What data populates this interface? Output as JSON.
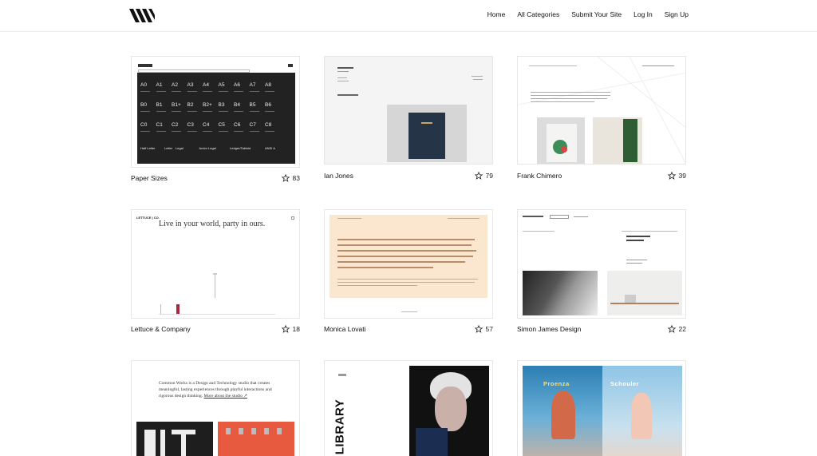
{
  "header": {
    "logo_icon": "site-logo-icon",
    "nav": [
      "Home",
      "All Categories",
      "Submit Your Site",
      "Log In",
      "Sign Up"
    ]
  },
  "cards": [
    {
      "title": "Paper Sizes",
      "favorites": "83"
    },
    {
      "title": "Ian Jones",
      "favorites": "79"
    },
    {
      "title": "Frank Chimero",
      "favorites": "39"
    },
    {
      "title": "Lettuce & Company",
      "favorites": "18"
    },
    {
      "title": "Monica Lovati",
      "favorites": "57"
    },
    {
      "title": "Simon James Design",
      "favorites": "22"
    }
  ],
  "thumbs": {
    "paper_sizes": {
      "row1": [
        "A0",
        "A1",
        "A2",
        "A3",
        "A4",
        "A5",
        "A6",
        "A7",
        "A8"
      ],
      "row2": [
        "B0",
        "B1",
        "B1+",
        "B2",
        "B2+",
        "B3",
        "B4",
        "B5",
        "B6"
      ],
      "row3": [
        "C0",
        "C1",
        "C2",
        "C3",
        "C4",
        "C5",
        "C6",
        "C7",
        "C8"
      ],
      "row4": [
        "Half Letter",
        "Letter",
        "Legal",
        "Junior Legal",
        "Ledger/Tabloid",
        "ANSI A"
      ]
    },
    "lettuce": {
      "brand": "LETTUCE | CO.",
      "headline": "Live in your world, party in ours."
    },
    "common_works": {
      "text": "Common Works is a Design and Technology studio that creates meaningful, lasting experiences through playful interactions and rigorous design thinking.",
      "link": "More about the studio ↗"
    },
    "library": {
      "word": "LIBRARY"
    },
    "fashion": {
      "left": "Proenza",
      "right": "Schouler"
    }
  },
  "icons": {
    "star": "star-icon"
  }
}
